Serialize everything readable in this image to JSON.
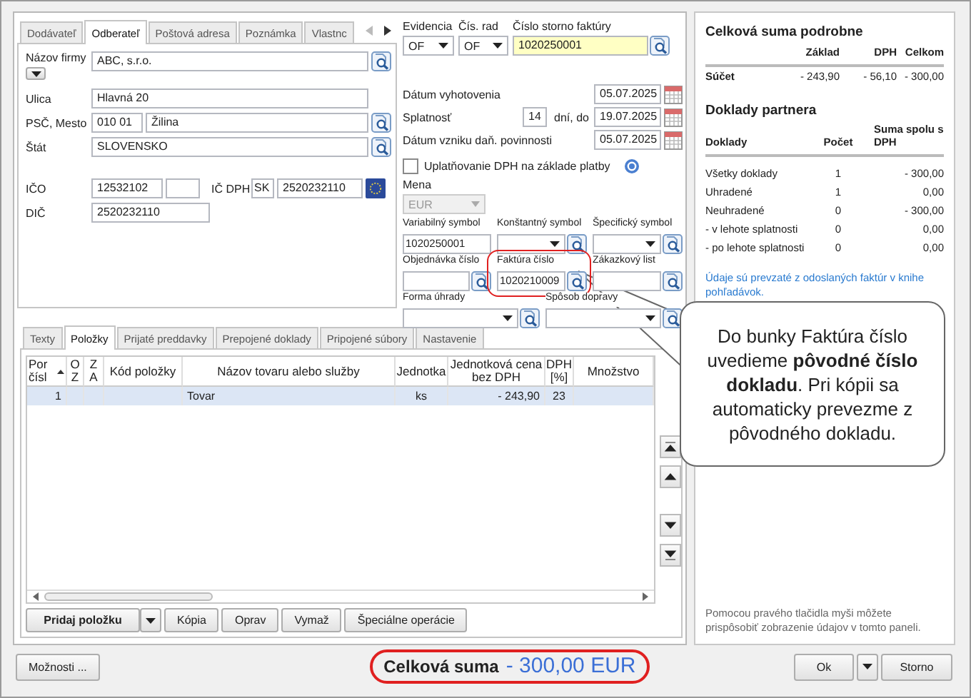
{
  "partner_tabs": [
    {
      "label": "Dodávateľ",
      "selected": false
    },
    {
      "label": "Odberateľ",
      "selected": true
    },
    {
      "label": "Poštová adresa",
      "selected": false
    },
    {
      "label": "Poznámka",
      "selected": false
    },
    {
      "label": "Vlastnc",
      "selected": false
    }
  ],
  "customer": {
    "name": {
      "label": "Názov firmy",
      "value": "ABC, s.r.o."
    },
    "street": {
      "label": "Ulica",
      "value": "Hlavná 20"
    },
    "city": {
      "label": "PSČ, Mesto",
      "zip": "010 01",
      "value": "Žilina"
    },
    "country": {
      "label": "Štát",
      "value": "SLOVENSKO"
    },
    "ico": {
      "label": "IČO",
      "value": "12532102"
    },
    "vat_id": {
      "label": "IČ DPH",
      "prefix": "SK",
      "value": "2520232110"
    },
    "tax_id": {
      "label": "DIČ",
      "value": "2520232110"
    }
  },
  "document": {
    "evidencia": {
      "label": "Evidencia",
      "value": "OF"
    },
    "series": {
      "label": "Čís. rad",
      "value": "OF"
    },
    "storno_number": {
      "label": "Číslo storno faktúry",
      "value": "1020250001"
    },
    "dates": [
      {
        "label": "Dátum vyhotovenia",
        "value": "05.07.2025"
      },
      {
        "label": "Splatnosť",
        "days": "14",
        "days_label": "dní, do",
        "value": "19.07.2025"
      },
      {
        "label": "Dátum vzniku daň. povinnosti",
        "value": "05.07.2025"
      }
    ],
    "vat_on_payment": {
      "label": "Uplatňovanie DPH na základe platby",
      "checked": false
    },
    "currency": {
      "label": "Mena",
      "value": "EUR",
      "disabled": true
    },
    "symbols": [
      {
        "label": "Variabilný symbol",
        "value": "1020250001",
        "kind": "text",
        "lookup": false,
        "highlighted": false
      },
      {
        "label": "Konštantný symbol",
        "kind": "combo",
        "lookup": true,
        "highlighted": false
      },
      {
        "label": "Špecifický symbol",
        "kind": "combo",
        "lookup": true,
        "highlighted": false
      },
      {
        "label": "Objednávka číslo",
        "kind": "text",
        "lookup": true,
        "highlighted": false
      },
      {
        "label": "Faktúra číslo",
        "value": "1020210009",
        "kind": "text",
        "lookup": true,
        "highlighted": true
      },
      {
        "label": "Zákazkový list",
        "kind": "text",
        "lookup": true,
        "highlighted": false
      },
      {
        "label": "Forma úhrady",
        "kind": "combo",
        "lookup": true,
        "highlighted": false
      },
      {
        "label": "Spôsob dopravy",
        "kind": "combo",
        "lookup": true,
        "highlighted": false
      }
    ]
  },
  "items": {
    "tabs": [
      {
        "label": "Texty",
        "selected": false
      },
      {
        "label": "Položky",
        "selected": true
      },
      {
        "label": "Prijaté preddavky",
        "selected": false
      },
      {
        "label": "Prepojené doklady",
        "selected": false
      },
      {
        "label": "Pripojené súbory",
        "selected": false
      },
      {
        "label": "Nastavenie",
        "selected": false
      }
    ],
    "columns": [
      "Por čísl",
      "O Z",
      "Z A",
      "Kód položky",
      "Názov tovaru alebo služby",
      "Jednotka",
      "Jednotková cena bez DPH",
      "DPH [%]",
      "Množstvo"
    ],
    "rows": [
      {
        "number": "1",
        "name": "Tovar",
        "unit": "ks",
        "unit_price": "-  243,90",
        "vat": "23",
        "selected": true
      }
    ],
    "buttons": [
      {
        "label": "Pridaj položku",
        "kind": "split"
      },
      {
        "label": "Kópia",
        "kind": "plain"
      },
      {
        "label": "Oprav",
        "kind": "plain"
      },
      {
        "label": "Vymaž",
        "kind": "plain"
      },
      {
        "label": "Špeciálne operácie",
        "kind": "plain"
      }
    ]
  },
  "summary": {
    "title": "Celková suma podrobne",
    "columns": [
      "Základ",
      "DPH",
      "Celkom"
    ],
    "rows": [
      {
        "label": "Súčet",
        "values": [
          "- 243,90",
          "- 56,10",
          "- 300,00"
        ]
      }
    ],
    "partner_title": "Doklady partnera",
    "partner_columns": [
      "Doklady",
      "Počet",
      "Suma spolu s DPH"
    ],
    "partner_rows": [
      {
        "label": "Všetky doklady",
        "count": "1",
        "sum": "- 300,00"
      },
      {
        "label": "Uhradené",
        "count": "1",
        "sum": "0,00"
      },
      {
        "label": "Neuhradené",
        "count": "0",
        "sum": "- 300,00"
      },
      {
        "label": "- v lehote splatnosti",
        "count": "0",
        "sum": "0,00"
      },
      {
        "label": "- po lehote splatnosti",
        "count": "0",
        "sum": "0,00"
      }
    ],
    "note": "Údaje sú prevzaté z odoslaných faktúr v knihe pohľadávok.",
    "hint": "Pomocou pravého tlačidla myši môžete prispôsobiť zobrazenie údajov v tomto paneli."
  },
  "bottom": {
    "options_button": "Možnosti ...",
    "total": {
      "label": "Celková suma",
      "value": "- 300,00 EUR",
      "highlighted": true
    },
    "ok_button": "Ok",
    "cancel_button": "Storno"
  },
  "callout": "Do bunky Faktúra číslo uvedieme **pôvodné číslo dokladu**. Pri kópii sa automaticky prevezme z pôvodného dokladu."
}
